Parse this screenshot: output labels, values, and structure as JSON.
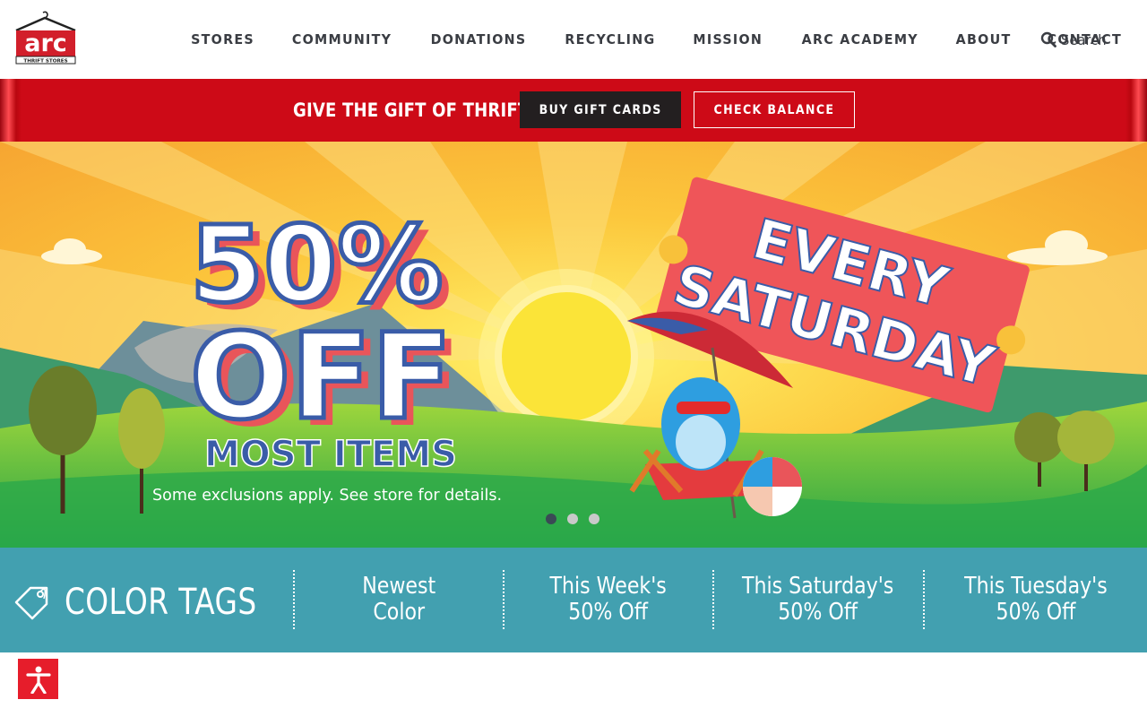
{
  "header": {
    "logo_text": "arc",
    "logo_sub": "THRIFT STORES",
    "nav": [
      "STORES",
      "COMMUNITY",
      "DONATIONS",
      "RECYCLING",
      "MISSION",
      "ARC ACADEMY",
      "ABOUT",
      "CONTACT"
    ],
    "search_label": "Search"
  },
  "promo": {
    "text": "GIVE THE GIFT OF THRIFT!",
    "buy_label": "BUY GIFT CARDS",
    "check_label": "CHECK BALANCE"
  },
  "hero": {
    "headline_1": "50%",
    "headline_2": "OFF",
    "sub_headline": "MOST ITEMS",
    "banner_1": "EVERY",
    "banner_2": "SATURDAY",
    "disclaimer": "Some exclusions apply. See store for details.",
    "slide_count": 3,
    "active_slide": 1
  },
  "color_tags": {
    "title": "COLOR TAGS",
    "items": [
      "Newest\nColor",
      "This Week's\n50% Off",
      "This Saturday's\n50% Off",
      "This Tuesday's\n50% Off"
    ]
  },
  "colors": {
    "red": "#cd0a17",
    "teal": "#42a0b0",
    "dark": "#231f20",
    "nav_text": "#3a3d43"
  },
  "icons": [
    "search-icon",
    "tag-icon",
    "accessibility-icon"
  ]
}
